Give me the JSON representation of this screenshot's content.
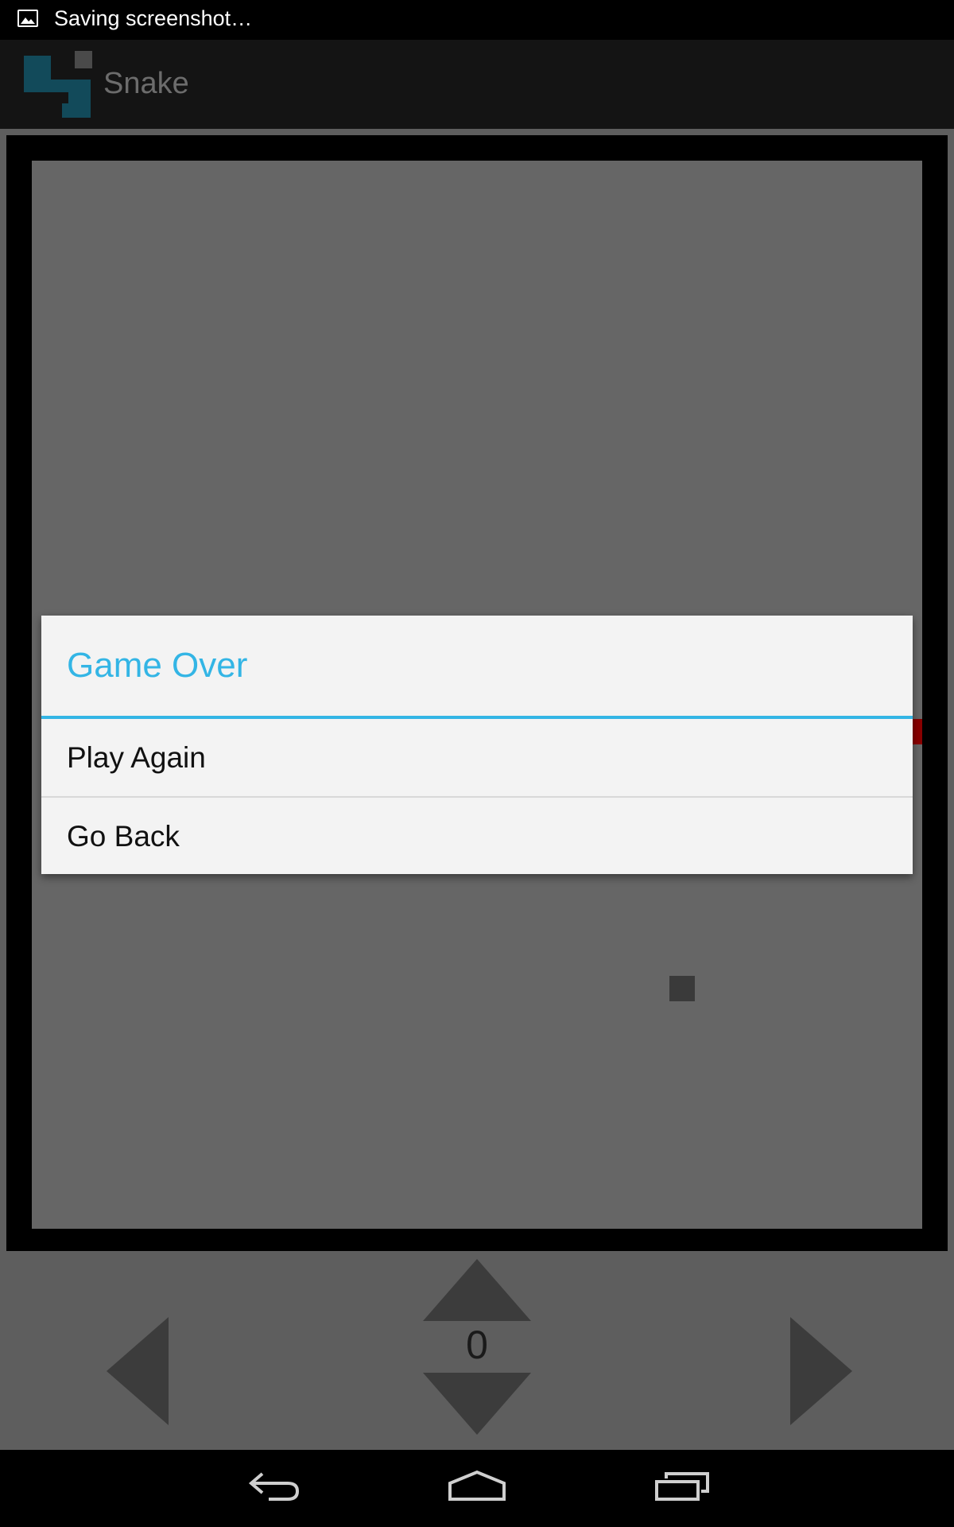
{
  "status_bar": {
    "notification_text": "Saving screenshot…",
    "icon": "image-icon"
  },
  "action_bar": {
    "title": "Snake",
    "logo_icon": "snake-logo-icon"
  },
  "dialog": {
    "title": "Game Over",
    "options": [
      {
        "label": "Play Again"
      },
      {
        "label": "Go Back"
      }
    ]
  },
  "controls": {
    "score": "0",
    "icons": [
      "arrow-up-icon",
      "arrow-down-icon",
      "arrow-left-icon",
      "arrow-right-icon"
    ]
  },
  "nav_bar": {
    "icons": [
      "back-icon",
      "home-icon",
      "recents-icon"
    ]
  },
  "colors": {
    "accent": "#33b5e5",
    "board": "#666666",
    "snake": "#8a0000"
  }
}
